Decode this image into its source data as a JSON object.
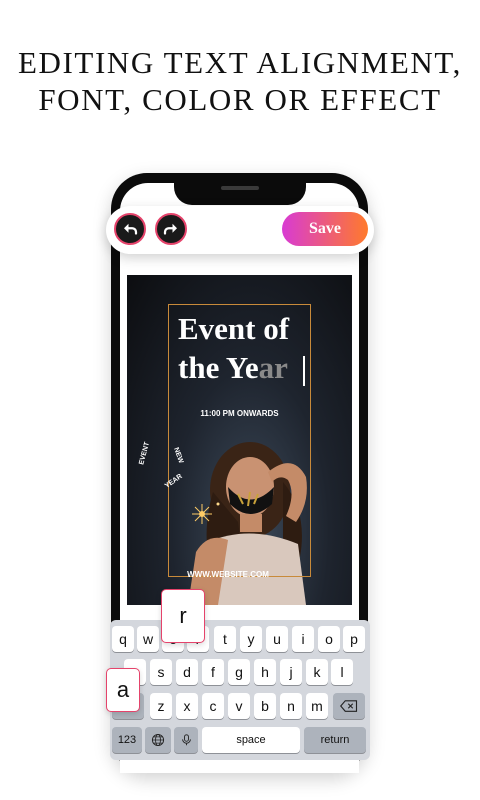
{
  "headline": {
    "line1": "EDITING TEXT ALIGNMENT,",
    "line2": "FONT, COLOR OR EFFECT"
  },
  "toolbar": {
    "undo_icon": "undo-arrow",
    "redo_icon": "redo-arrow",
    "save_label": "Save",
    "save_gradient": [
      "#d83bd3",
      "#ff7a2b"
    ],
    "accent": "#e5436b"
  },
  "poster": {
    "title_line1": "Event of",
    "title_line2_main": "the Ye",
    "title_line2_fade": "ar",
    "time_text": "11:00 PM ONWARDS",
    "curve_word1": "EVENT",
    "curve_word2": "NEW",
    "curve_word3": "YEAR",
    "website": "WWW.WEBSITE.COM",
    "frame_color": "#c88a3a"
  },
  "keyboard": {
    "row1": [
      "q",
      "w",
      "e",
      "r",
      "t",
      "y",
      "u",
      "i",
      "o",
      "p"
    ],
    "row2": [
      "a",
      "s",
      "d",
      "f",
      "g",
      "h",
      "j",
      "k",
      "l"
    ],
    "row3": [
      "z",
      "x",
      "c",
      "v",
      "b",
      "n",
      "m"
    ],
    "numbers_key": "123",
    "space_key": "space",
    "return_key": "return",
    "popup_top": "r",
    "popup_left": "a"
  }
}
